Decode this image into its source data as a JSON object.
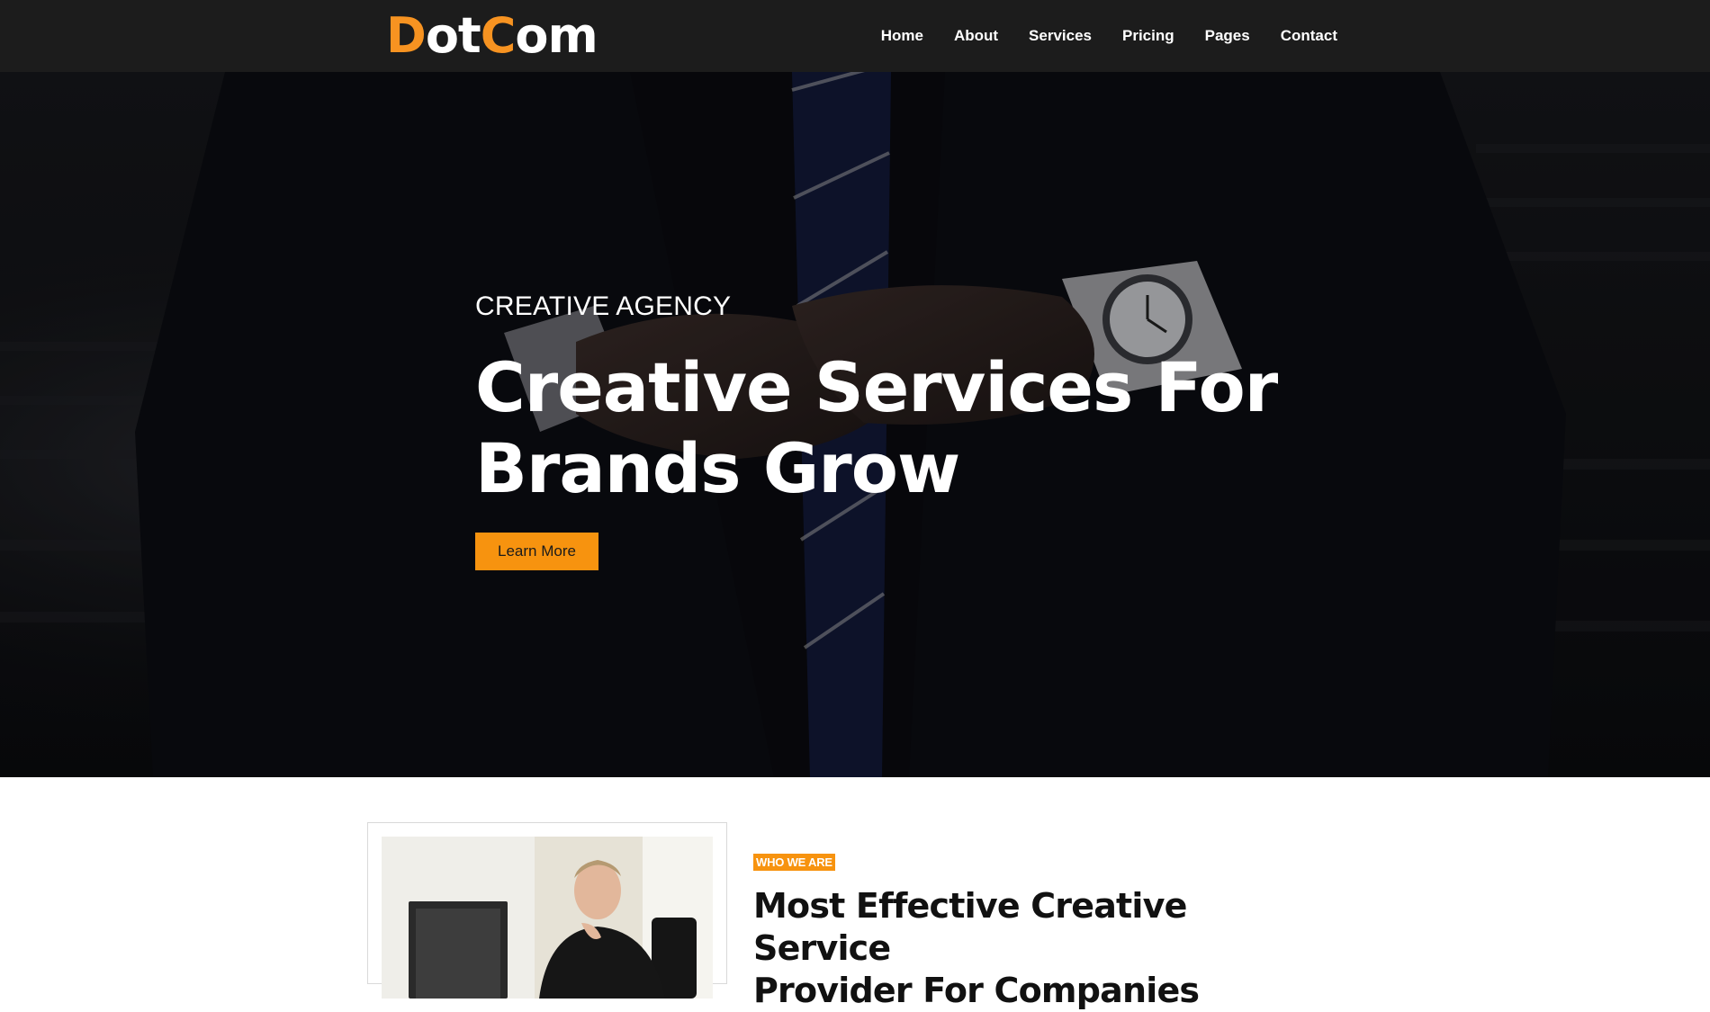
{
  "header": {
    "logo": {
      "part1": "D",
      "part2": "ot",
      "part3": "C",
      "part4": "om"
    },
    "nav": [
      "Home",
      "About",
      "Services",
      "Pricing",
      "Pages",
      "Contact"
    ]
  },
  "hero": {
    "eyebrow": "CREATIVE AGENCY",
    "title_line1": "Creative Services For",
    "title_line2": "Brands Grow",
    "cta": "Learn More"
  },
  "about": {
    "tag": "WHO WE ARE",
    "title_line1": "Most Effective Creative Service",
    "title_line2": "Provider For Companies"
  },
  "colors": {
    "accent": "#f7930f",
    "header_bg": "#1c1c1c",
    "text_dark": "#111111"
  }
}
